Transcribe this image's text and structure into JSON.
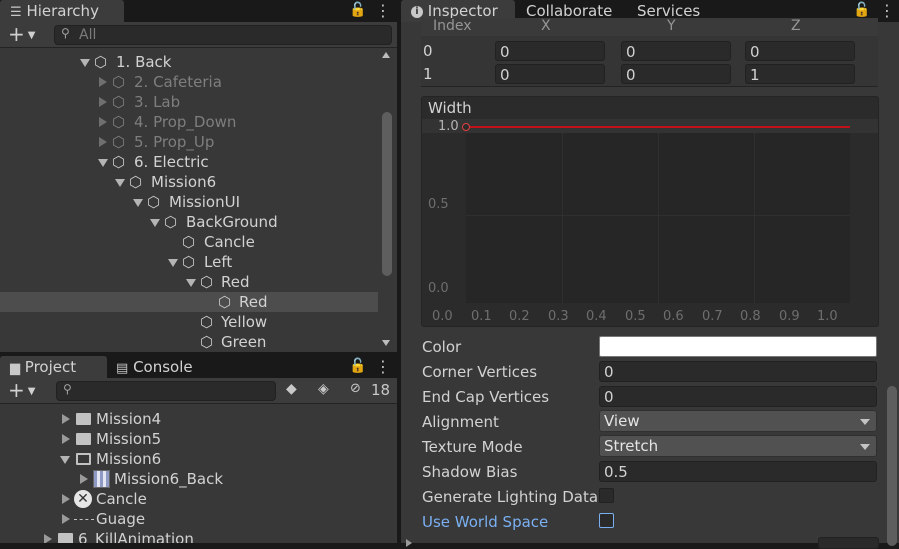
{
  "hierarchy": {
    "title": "Hierarchy",
    "search_placeholder": "All",
    "rows": [
      {
        "label": "1. Back"
      },
      {
        "label": "2. Cafeteria"
      },
      {
        "label": "3. Lab"
      },
      {
        "label": "4. Prop_Down"
      },
      {
        "label": "5. Prop_Up"
      },
      {
        "label": "6. Electric"
      },
      {
        "label": "Mission6"
      },
      {
        "label": "MissionUI"
      },
      {
        "label": "BackGround"
      },
      {
        "label": "Cancle"
      },
      {
        "label": "Left"
      },
      {
        "label": "Red"
      },
      {
        "label": "Red"
      },
      {
        "label": "Yellow"
      },
      {
        "label": "Green"
      }
    ]
  },
  "project": {
    "tab_project": "Project",
    "tab_console": "Console",
    "hidden_count": "18",
    "rows": [
      {
        "label": "Mission4"
      },
      {
        "label": "Mission5"
      },
      {
        "label": "Mission6"
      },
      {
        "label": "Mission6_Back"
      },
      {
        "label": "Cancle"
      },
      {
        "label": "Guage"
      },
      {
        "label": "6_KillAnimation"
      }
    ]
  },
  "inspector": {
    "tabs": [
      "Inspector",
      "Collaborate",
      "Services"
    ],
    "positions": {
      "headers": [
        "Index",
        "X",
        "Y",
        "Z"
      ],
      "rows": [
        {
          "index": "0",
          "x": "0",
          "y": "0",
          "z": "0"
        },
        {
          "index": "1",
          "x": "0",
          "y": "0",
          "z": "1"
        }
      ]
    },
    "width_curve": {
      "title": "Width",
      "y_ticks": [
        "1.0",
        "0.5",
        "0.0"
      ],
      "x_ticks": [
        "0.0",
        "0.1",
        "0.2",
        "0.3",
        "0.4",
        "0.5",
        "0.6",
        "0.7",
        "0.8",
        "0.9",
        "1.0"
      ],
      "curve_color": "#c1121c"
    },
    "properties": {
      "color_label": "Color",
      "color_value": "#ffffff",
      "corner_vertices_label": "Corner Vertices",
      "corner_vertices": "0",
      "end_cap_vertices_label": "End Cap Vertices",
      "end_cap_vertices": "0",
      "alignment_label": "Alignment",
      "alignment": "View",
      "texture_mode_label": "Texture Mode",
      "texture_mode": "Stretch",
      "shadow_bias_label": "Shadow Bias",
      "shadow_bias": "0.5",
      "generate_lighting_label": "Generate Lighting Data",
      "use_world_space_label": "Use World Space"
    }
  },
  "colors": {
    "accent_blue": "#7ab0f2",
    "selected_row": "#4d4d4d"
  }
}
